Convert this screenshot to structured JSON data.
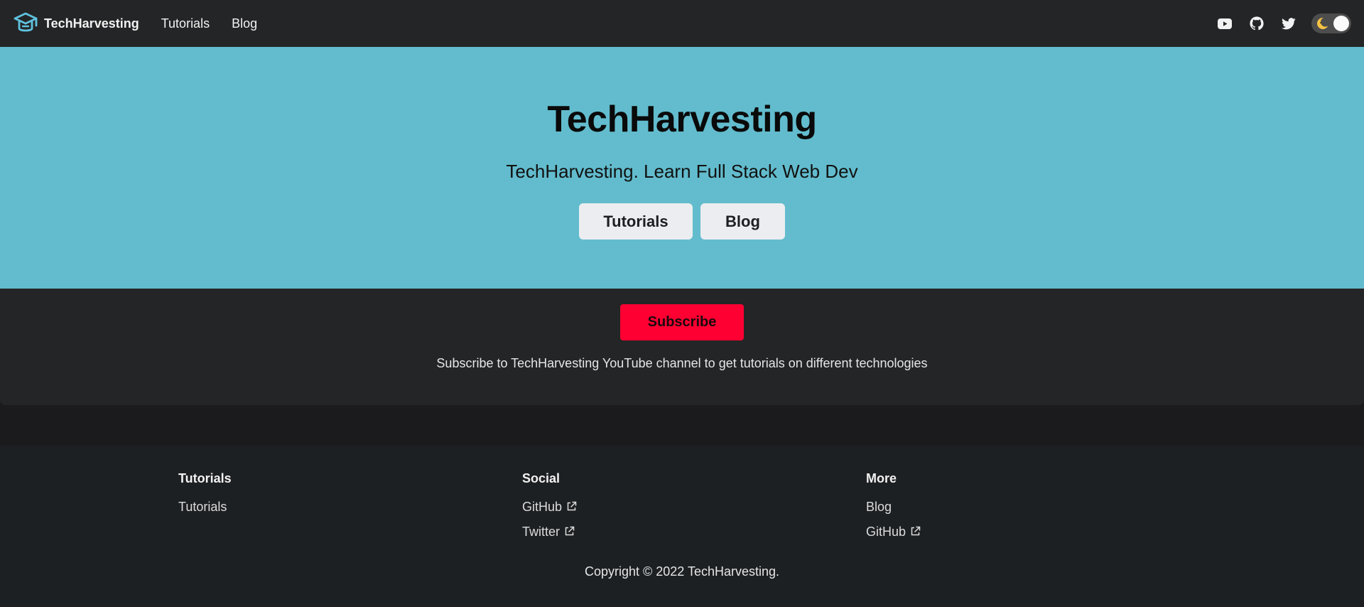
{
  "navbar": {
    "brand_title": "TechHarvesting",
    "links": [
      "Tutorials",
      "Blog"
    ],
    "icons": [
      "youtube-icon",
      "github-icon",
      "twitter-icon"
    ],
    "theme_toggle": "dark-mode-toggle"
  },
  "hero": {
    "title": "TechHarvesting",
    "tagline": "TechHarvesting. Learn Full Stack Web Dev",
    "buttons": [
      "Tutorials",
      "Blog"
    ],
    "background": "#62bccd"
  },
  "subscribe": {
    "button_label": "Subscribe",
    "button_color": "#fe0032",
    "text": "Subscribe to TechHarvesting YouTube channel to get tutorials on different technologies"
  },
  "footer": {
    "columns": [
      {
        "title": "Tutorials",
        "links": [
          "Tutorials"
        ]
      },
      {
        "title": "Social",
        "links": [
          "GitHub",
          "Twitter"
        ]
      },
      {
        "title": "More",
        "links": [
          "Blog",
          "GitHub"
        ]
      }
    ],
    "copyright": "Copyright © 2022 TechHarvesting."
  }
}
